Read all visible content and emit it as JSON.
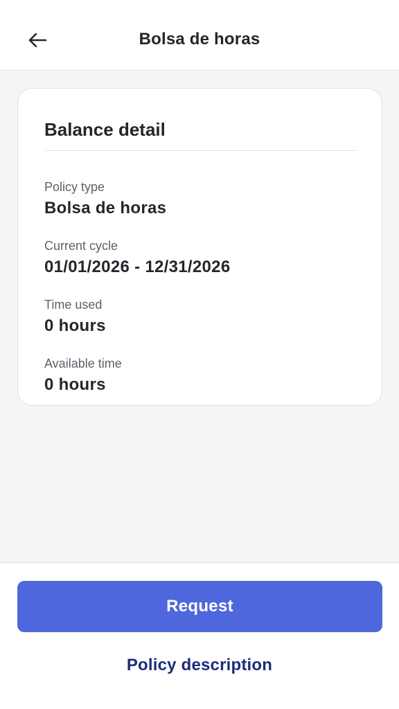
{
  "header": {
    "title": "Bolsa de horas",
    "back_icon": "arrow-left-icon"
  },
  "card": {
    "title": "Balance detail",
    "fields": [
      {
        "label": "Policy type",
        "value": "Bolsa de horas"
      },
      {
        "label": "Current cycle",
        "value": "01/01/2026 - 12/31/2026"
      },
      {
        "label": "Time used",
        "value": "0 hours"
      },
      {
        "label": "Available time",
        "value": "0 hours"
      }
    ]
  },
  "footer": {
    "request_label": "Request",
    "policy_link_label": "Policy description"
  },
  "colors": {
    "primary": "#4f67dc",
    "link": "#1f2b7a",
    "background": "#f4f5f7"
  }
}
